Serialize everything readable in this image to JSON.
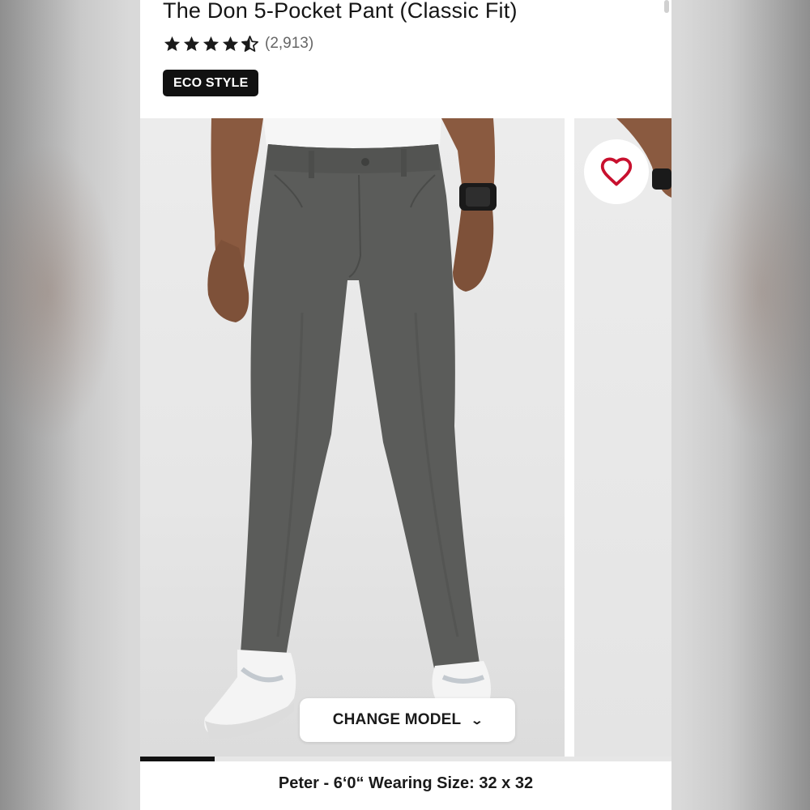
{
  "product": {
    "title": "The Don 5-Pocket Pant (Classic Fit)",
    "rating": 4.5,
    "review_count": "(2,913)",
    "badge": "ECO STYLE"
  },
  "gallery": {
    "image_alt": "Man wearing dark gray 5-pocket pants with white sneakers",
    "change_model_label": "CHANGE MODEL",
    "progress": 0.14,
    "caption": "Peter - 6‘0“ Wearing Size: 32 x 32"
  },
  "icons": {
    "favorite": "heart-icon",
    "dropdown": "chevron-down-icon",
    "rating": "star-icon"
  },
  "colors": {
    "pant": "#5b5c5a",
    "heart": "#c8102e",
    "badge_bg": "#111111"
  }
}
